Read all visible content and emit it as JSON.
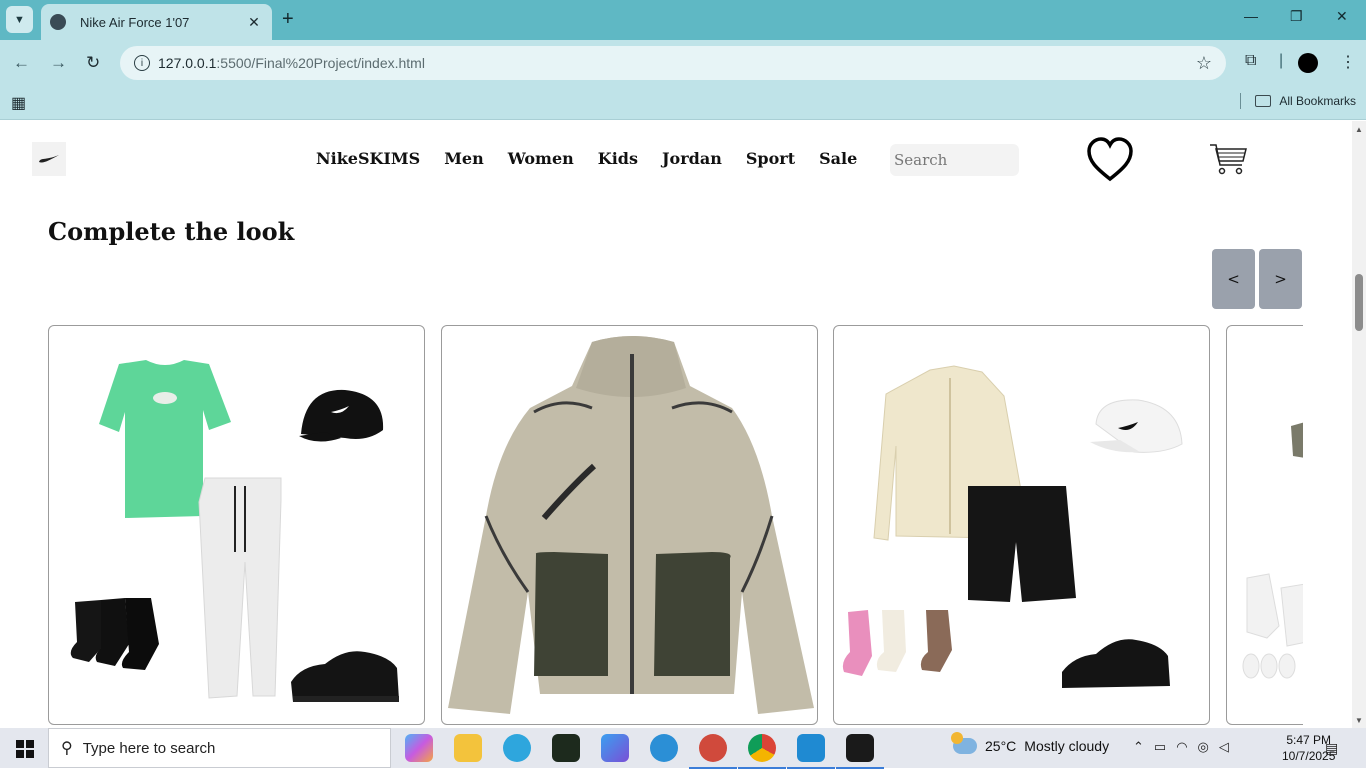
{
  "browser": {
    "tab_title": "Nike Air Force 1'07",
    "tab_close": "✕",
    "new_tab": "+",
    "url_host": "127.0.0.1",
    "url_path": ":5500/Final%20Project/index.html",
    "bookmarks_label": "All Bookmarks",
    "controls": {
      "minimize": "—",
      "restore": "❐",
      "close": "✕"
    }
  },
  "site": {
    "nav": [
      "NikeSKIMS",
      "Men",
      "Women",
      "Kids",
      "Jordan",
      "Sport",
      "Sale"
    ],
    "search_placeholder": "Search",
    "section_title": "Complete the look",
    "prev_label": "<",
    "next_label": ">",
    "cards": [
      {
        "name": "outfit-green-tee",
        "items": [
          "green t-shirt",
          "black cap",
          "grey joggers",
          "black socks",
          "black sneaker"
        ]
      },
      {
        "name": "tech-fleece-jacket",
        "items": [
          "khaki tech jacket"
        ]
      },
      {
        "name": "outfit-cream-shirt",
        "items": [
          "cream shirt",
          "white cap",
          "black shorts",
          "socks",
          "black sneaker"
        ]
      },
      {
        "name": "outfit-partial",
        "items": [
          "white socks"
        ]
      }
    ]
  },
  "taskbar": {
    "search_placeholder": "Type here to search",
    "weather_temp": "25°C",
    "weather_text": "Mostly cloudy",
    "time": "5:47 PM",
    "date": "10/7/2025"
  },
  "colors": {
    "tabbar": "#5fb8c4",
    "toolbar": "#bfe3e8",
    "arrow_button": "#9aa1ac"
  }
}
